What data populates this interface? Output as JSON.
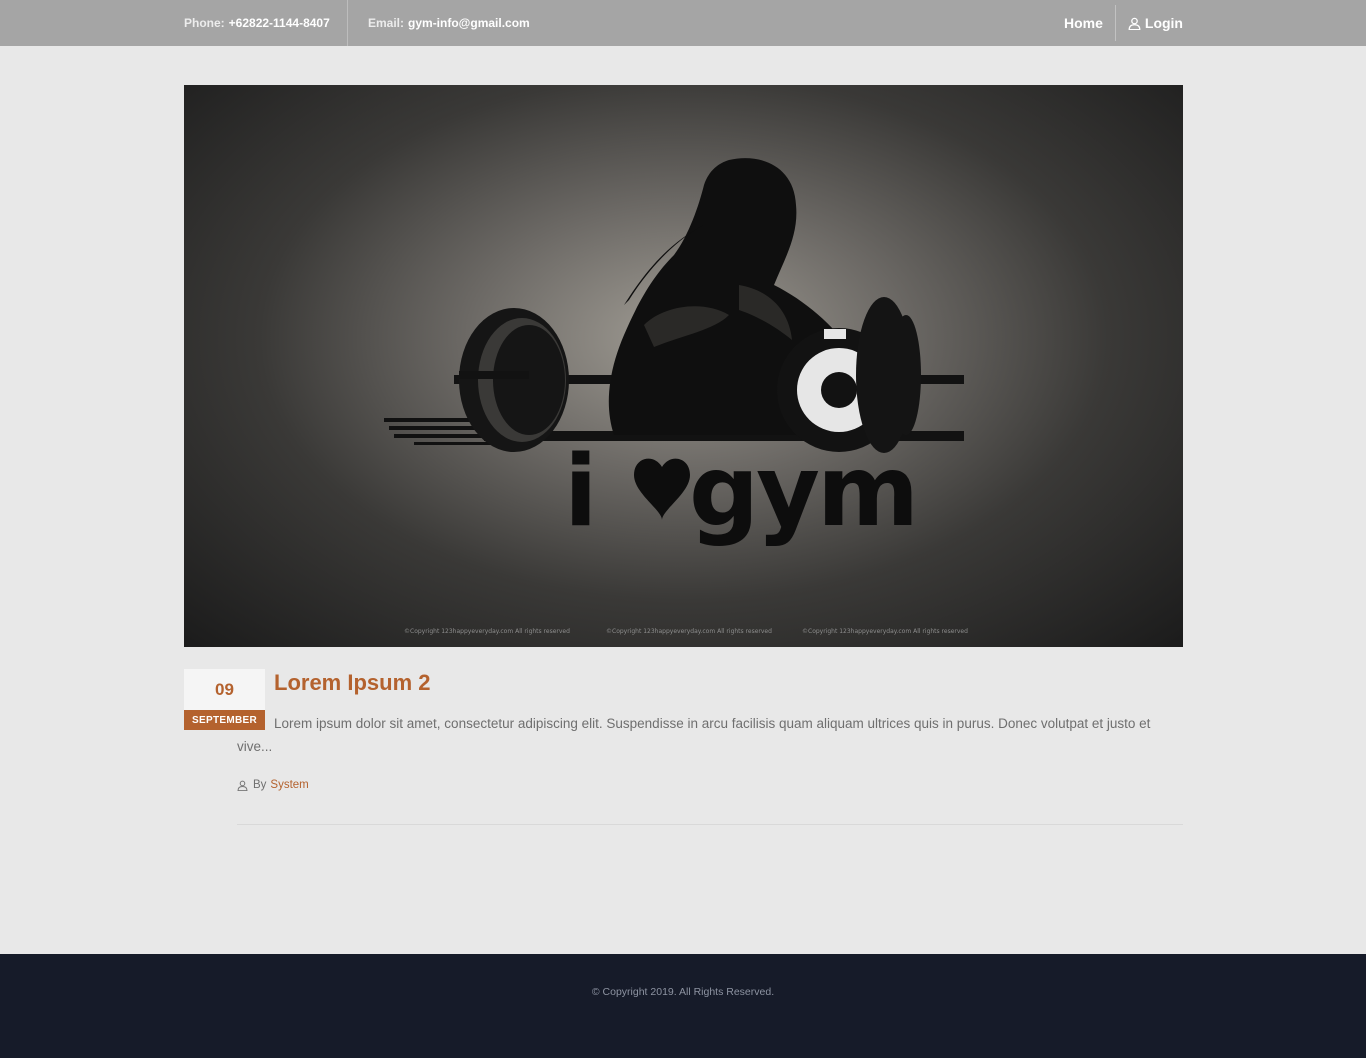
{
  "topbar": {
    "phone_label": "Phone:",
    "phone_value": "+62822-1144-8407",
    "email_label": "Email:",
    "email_value": "gym-info@gmail.com",
    "nav": {
      "home": "Home",
      "login": "Login"
    }
  },
  "hero": {
    "logo_text": "i♥gym",
    "copyright_marks": [
      "©Copyright 123happyeveryday.com All rights reserved",
      "©Copyright 123happyeveryday.com All rights reserved",
      "©Copyright 123happyeveryday.com All rights reserved"
    ]
  },
  "post": {
    "date_day": "09",
    "date_month": "SEPTEMBER",
    "title": "Lorem Ipsum 2",
    "excerpt": "Lorem ipsum dolor sit amet, consectetur adipiscing elit. Suspendisse in arcu facilisis quam aliquam ultrices quis in purus. Donec volutpat et justo et vive...",
    "by_label": "By",
    "author": "System"
  },
  "footer": {
    "copyright": "© Copyright 2019. All Rights Reserved."
  },
  "colors": {
    "accent": "#b4622e",
    "topbar_bg": "#a5a5a5",
    "page_bg": "#e8e8e8",
    "footer_bg": "#161b29"
  },
  "icons": {
    "login": "user-icon",
    "author": "user-icon"
  }
}
